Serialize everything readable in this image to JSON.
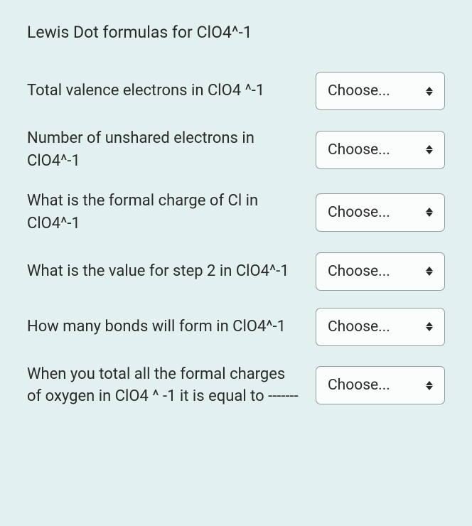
{
  "title": "Lewis Dot formulas for ClO4^-1",
  "dropdown_placeholder": "Choose...",
  "questions": [
    {
      "label": "Total valence electrons in ClO4 ^-1"
    },
    {
      "label": "Number of unshared electrons in ClO4^-1"
    },
    {
      "label": "What is the formal charge of Cl in ClO4^-1"
    },
    {
      "label": "What is the value for step 2 in ClO4^-1"
    },
    {
      "label": "How many bonds will form in ClO4^-1"
    },
    {
      "label": "When you total all the formal charges  of oxygen  in ClO4 ^ -1  it is equal to -------"
    }
  ]
}
